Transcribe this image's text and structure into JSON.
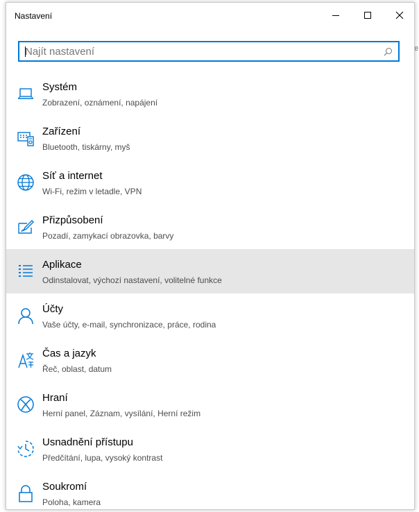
{
  "window": {
    "title": "Nastavení",
    "controls": {
      "minimize": "minimize-icon",
      "maximize": "maximize-icon",
      "close": "close-icon"
    }
  },
  "search": {
    "placeholder": "Najít nastavení",
    "value": "",
    "icon": "search-icon"
  },
  "colors": {
    "accent": "#0078d7",
    "selected_bg": "#e6e6e6"
  },
  "categories": [
    {
      "label": "Systém",
      "description": "Zobrazení, oznámení, napájení",
      "icon": "laptop-icon"
    },
    {
      "label": "Zařízení",
      "description": "Bluetooth, tiskárny, myš",
      "icon": "devices-icon"
    },
    {
      "label": "Síť a internet",
      "description": "Wi-Fi, režim v letadle, VPN",
      "icon": "globe-icon"
    },
    {
      "label": "Přizpůsobení",
      "description": "Pozadí, zamykací obrazovka, barvy",
      "icon": "personalization-icon"
    },
    {
      "label": "Aplikace",
      "description": "Odinstalovat, výchozí nastavení, volitelné funkce",
      "icon": "apps-list-icon",
      "selected": true
    },
    {
      "label": "Účty",
      "description": "Vaše účty, e-mail, synchronizace, práce, rodina",
      "icon": "person-icon"
    },
    {
      "label": "Čas a jazyk",
      "description": "Řeč, oblast, datum",
      "icon": "time-language-icon"
    },
    {
      "label": "Hraní",
      "description": "Herní panel, Záznam, vysílání, Herní režim",
      "icon": "xbox-icon"
    },
    {
      "label": "Usnadnění přístupu",
      "description": "Předčítání, lupa, vysoký kontrast",
      "icon": "ease-of-access-icon"
    },
    {
      "label": "Soukromí",
      "description": "Poloha, kamera",
      "icon": "lock-icon"
    }
  ]
}
